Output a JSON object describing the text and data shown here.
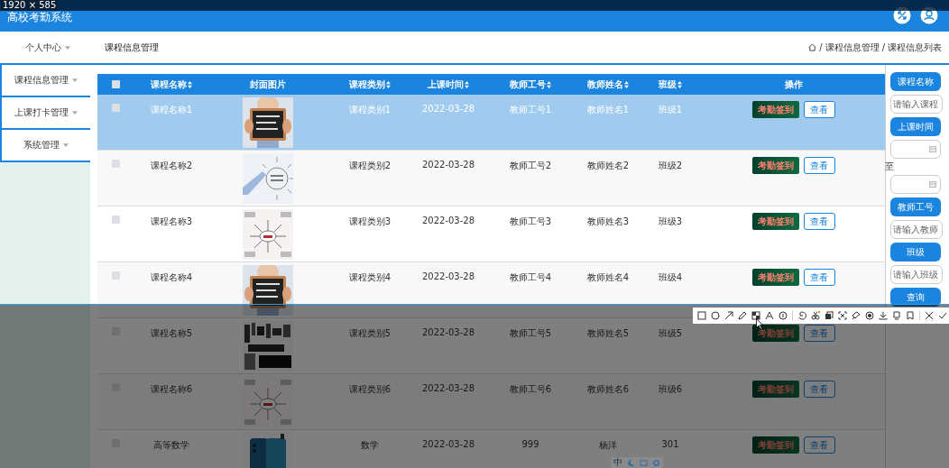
{
  "capture_size": "1920 × 585",
  "app": {
    "title": "高校考勤系统"
  },
  "nav": {
    "menu": "个人中心",
    "page_title": "课程信息管理",
    "breadcrumb": [
      {
        "separator": "/",
        "label": "课程信息管理"
      },
      {
        "separator": "/",
        "label": "课程信息列表"
      }
    ]
  },
  "sidebar": {
    "items": [
      {
        "label": "课程信息管理"
      },
      {
        "label": "上课打卡管理"
      },
      {
        "label": "系统管理"
      }
    ]
  },
  "table": {
    "all_checked": false,
    "columns": [
      {
        "label": "课程名称",
        "sortable": true
      },
      {
        "label": "封面图片",
        "sortable": false
      },
      {
        "label": "课程类别",
        "sortable": true
      },
      {
        "label": "上课时间",
        "sortable": true
      },
      {
        "label": "教师工号",
        "sortable": true
      },
      {
        "label": "教师姓名",
        "sortable": true
      },
      {
        "label": "班级",
        "sortable": true
      },
      {
        "label": "操作",
        "sortable": false
      }
    ],
    "rows": [
      {
        "selected": true,
        "checked": false,
        "course_name": "课程名称1",
        "cover": {
          "kind": "picture"
        },
        "category": "课程类别1",
        "time": "2022-03-28",
        "teacher_id": "教师工号1",
        "teacher_name": "教师姓名1",
        "class": "班级1",
        "actions": [
          "考勤签到",
          "查看"
        ]
      },
      {
        "selected": false,
        "checked": false,
        "course_name": "课程名称2",
        "cover": {
          "kind": "picture"
        },
        "category": "课程类别2",
        "time": "2022-03-28",
        "teacher_id": "教师工号2",
        "teacher_name": "教师姓名2",
        "class": "班级2",
        "actions": [
          "考勤签到",
          "查看"
        ]
      },
      {
        "selected": false,
        "checked": false,
        "course_name": "课程名称3",
        "cover": {
          "kind": "picture"
        },
        "category": "课程类别3",
        "time": "2022-03-28",
        "teacher_id": "教师工号3",
        "teacher_name": "教师姓名3",
        "class": "班级3",
        "actions": [
          "考勤签到",
          "查看"
        ]
      },
      {
        "selected": false,
        "checked": false,
        "course_name": "课程名称4",
        "cover": {
          "kind": "picture"
        },
        "category": "课程类别4",
        "time": "2022-03-28",
        "teacher_id": "教师工号4",
        "teacher_name": "教师姓名4",
        "class": "班级4",
        "actions": [
          "考勤签到",
          "查看"
        ]
      },
      {
        "selected": false,
        "checked": false,
        "course_name": "课程名称5",
        "cover": {
          "kind": "picture"
        },
        "category": "课程类别5",
        "time": "2022-03-28",
        "teacher_id": "教师工号5",
        "teacher_name": "教师姓名5",
        "class": "班级5",
        "actions": [
          "考勤签到",
          "查看"
        ]
      },
      {
        "selected": false,
        "checked": false,
        "course_name": "课程名称6",
        "cover": {
          "kind": "picture"
        },
        "category": "课程类别6",
        "time": "2022-03-28",
        "teacher_id": "教师工号6",
        "teacher_name": "教师姓名6",
        "class": "班级6",
        "actions": [
          "考勤签到",
          "查看"
        ]
      },
      {
        "selected": false,
        "checked": false,
        "course_name": "高等数学",
        "cover": {
          "kind": "picture"
        },
        "category": "数学",
        "time": "2022-03-28",
        "teacher_id": "999",
        "teacher_name": "杨洋",
        "class": "301",
        "actions": [
          "考勤签到",
          "查看"
        ]
      }
    ]
  },
  "filters": [
    {
      "kind": "button",
      "label": "课程名称"
    },
    {
      "kind": "input",
      "placeholder": "请输入课程"
    },
    {
      "kind": "button",
      "label": "上课时间"
    },
    {
      "kind": "date"
    },
    {
      "kind": "text",
      "label": "至"
    },
    {
      "kind": "date"
    },
    {
      "kind": "button",
      "label": "教师工号"
    },
    {
      "kind": "input",
      "placeholder": "请输入教师"
    },
    {
      "kind": "button",
      "label": "班级"
    },
    {
      "kind": "input",
      "placeholder": "请输入班级"
    },
    {
      "kind": "button",
      "label": "查询"
    }
  ],
  "ime_bar": {
    "label": "中"
  }
}
